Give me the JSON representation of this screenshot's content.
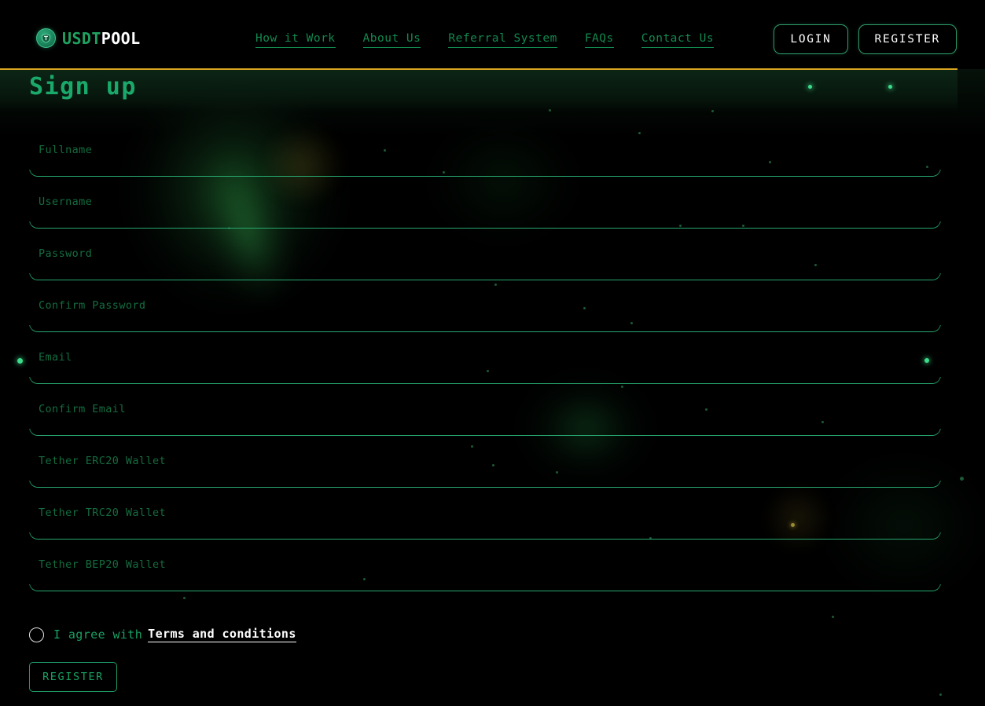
{
  "header": {
    "logo": {
      "icon": "tether-coin-icon",
      "text_primary": "USDT",
      "text_secondary": "POOL"
    },
    "nav": [
      {
        "label": "How it Work"
      },
      {
        "label": "About Us"
      },
      {
        "label": "Referral System"
      },
      {
        "label": "FAQs"
      },
      {
        "label": "Contact Us"
      }
    ],
    "login_label": "LOGIN",
    "register_label": "REGISTER"
  },
  "page": {
    "title": "Sign up"
  },
  "form": {
    "fields": [
      {
        "label": "Fullname",
        "value": "",
        "placeholder": ""
      },
      {
        "label": "Username",
        "value": "",
        "placeholder": ""
      },
      {
        "label": "Password",
        "value": "",
        "placeholder": ""
      },
      {
        "label": "Confirm Password",
        "value": "",
        "placeholder": ""
      },
      {
        "label": "Email",
        "value": "",
        "placeholder": ""
      },
      {
        "label": "Confirm Email",
        "value": "",
        "placeholder": ""
      },
      {
        "label": "Tether ERC20 Wallet",
        "value": "",
        "placeholder": ""
      },
      {
        "label": "Tether TRC20 Wallet",
        "value": "",
        "placeholder": ""
      },
      {
        "label": "Tether BEP20 Wallet",
        "value": "",
        "placeholder": ""
      }
    ],
    "agree_text": "I agree with",
    "agree_link": "Terms and conditions",
    "agree_checked": false,
    "submit_label": "REGISTER"
  },
  "colors": {
    "background": "#000000",
    "accent_green": "#1aa96a",
    "line_green": "#27a86f",
    "label_green": "#146c3f",
    "gold_rule": "#d9a520",
    "white": "#ffffff"
  }
}
